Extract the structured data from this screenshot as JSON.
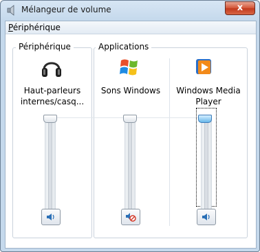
{
  "window": {
    "title": "Mélangeur de volume",
    "close_label": "x"
  },
  "menu": {
    "item_underline": "P",
    "item_rest": "ériphérique"
  },
  "groups": {
    "device_label": "Périphérique",
    "apps_label": "Applications"
  },
  "channels": [
    {
      "name_line1": "Haut-parleurs",
      "name_line2": "internes/casq...",
      "icon": "headphones-icon",
      "volume_percent": 100,
      "muted": false,
      "mute_icon": "speaker-icon"
    },
    {
      "name_line1": "Sons Windows",
      "name_line2": "",
      "icon": "windows-logo-icon",
      "volume_percent": 100,
      "muted": true,
      "mute_icon": "speaker-muted-icon"
    },
    {
      "name_line1": "Windows Media",
      "name_line2": "Player",
      "icon": "media-player-icon",
      "volume_percent": 100,
      "muted": false,
      "mute_icon": "speaker-icon"
    }
  ],
  "colors": {
    "accent": "#67b7ea",
    "mute_red": "#d33a2a"
  }
}
